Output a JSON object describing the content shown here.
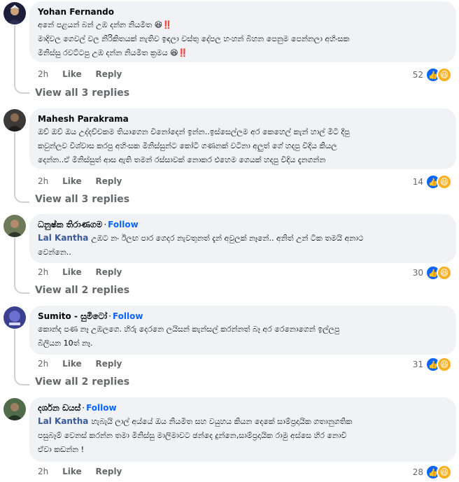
{
  "comments": [
    {
      "author": "Yohan Fernando",
      "follow": "",
      "tag": "",
      "lines": [
        "අනේ පළයන් බන් උඹ දන්න නියමිත 😆‼️",
        "මාදිවල ගෙවල් වල නිරිකිතයක් නැතිව ඉඳලා වස්තු දේපල හංහන් බිහන පෙනුම පෙන්නලා අහිංසක",
        "මිනිස්සු රවට්ටපු උඹ දන්න නියමිත ක්‍රමය 😆‼️"
      ],
      "time": "2h",
      "like": "Like",
      "reply": "Reply",
      "react_count": "52",
      "view_replies": "View all 3 replies"
    },
    {
      "author": "Mahesh Parakrama",
      "follow": "",
      "tag": "",
      "lines": [
        "ඔව් ඔව් ඔය උද්දච්චකම තියාගෙන විනෝදෙන් ඉන්න..ඉස්සෙල්ලම අර කෙහෙල් කැන් හාල් මිටි දීපු",
        "කවුන්ලව විශ්වාස කරපු අහිංසක මිනිස්සුන්ට කෝටි ගණනක් වටිනා අලුත් ගේ හදපු විදිය කියල",
        "දෙන්න..ඒ මිනිස්සුත් ආස ඇති තමන් රස්සාවක් නොකර එහෙම ගෙයක් හදපු විදිය දැනගන්න"
      ],
      "time": "2h",
      "like": "Like",
      "reply": "Reply",
      "react_count": "14",
      "view_replies": "View all 3 replies"
    },
    {
      "author": "ධනුෂ්ක තිරාණගම",
      "follow": "Follow",
      "tag": "Lal Kantha",
      "lines": [
        "උඹට නං ඊලඟ පාර ගෙදර නැවතුනත් දැන් අවුලක් නෑනේ.. අනිත් උන් ටික තමයි අනාථ",
        "වෙන්නෙ.."
      ],
      "time": "2h",
      "like": "Like",
      "reply": "Reply",
      "react_count": "30",
      "view_replies": "View all 2 replies"
    },
    {
      "author": "Sumito - සුමිටෝ",
      "follow": "Follow",
      "tag": "",
      "lines": [
        "කොන්ද පණ නෑ උඹලගෙ. හිරු දෙරනෙ ලයිසන් කැන්සල් කරන්නත් බෑ අර රෙනොගෙන් ඉල්ලපු",
        "බිලියන 10ත් නෑ."
      ],
      "time": "2h",
      "like": "Like",
      "reply": "Reply",
      "react_count": "31",
      "view_replies": "View all 2 replies"
    },
    {
      "author": "දර්ශන ඩයස්",
      "follow": "Follow",
      "tag": "Lal Kantha",
      "lines": [
        "හැබැයි ලාල් අය්යේ ඔය නියමිත සහ වයුහය කියන දෙකේ සාම්ප්‍රදායික ගතානුගතික",
        "පසුබෑම් වෙනස් කරන්න තමා මිනිස්සු මාලිමාවට ඡන්දෙ දුන්නෙ,සාම්ප්‍රදායික රාමු අස්සෙ හිර නොවී",
        "ඒවා කඩන්න !"
      ],
      "time": "2h",
      "like": "Like",
      "reply": "Reply",
      "react_count": "28",
      "view_replies": ""
    }
  ],
  "icons": {
    "like": "like-reaction-icon",
    "haha": "haha-reaction-icon"
  },
  "colors": {
    "bubble": "#f0f2f5",
    "follow": "#0866ff",
    "tag": "#385898",
    "meta": "#65676b",
    "like_blue": "#0866ff",
    "haha_yellow": "#f7b125"
  }
}
